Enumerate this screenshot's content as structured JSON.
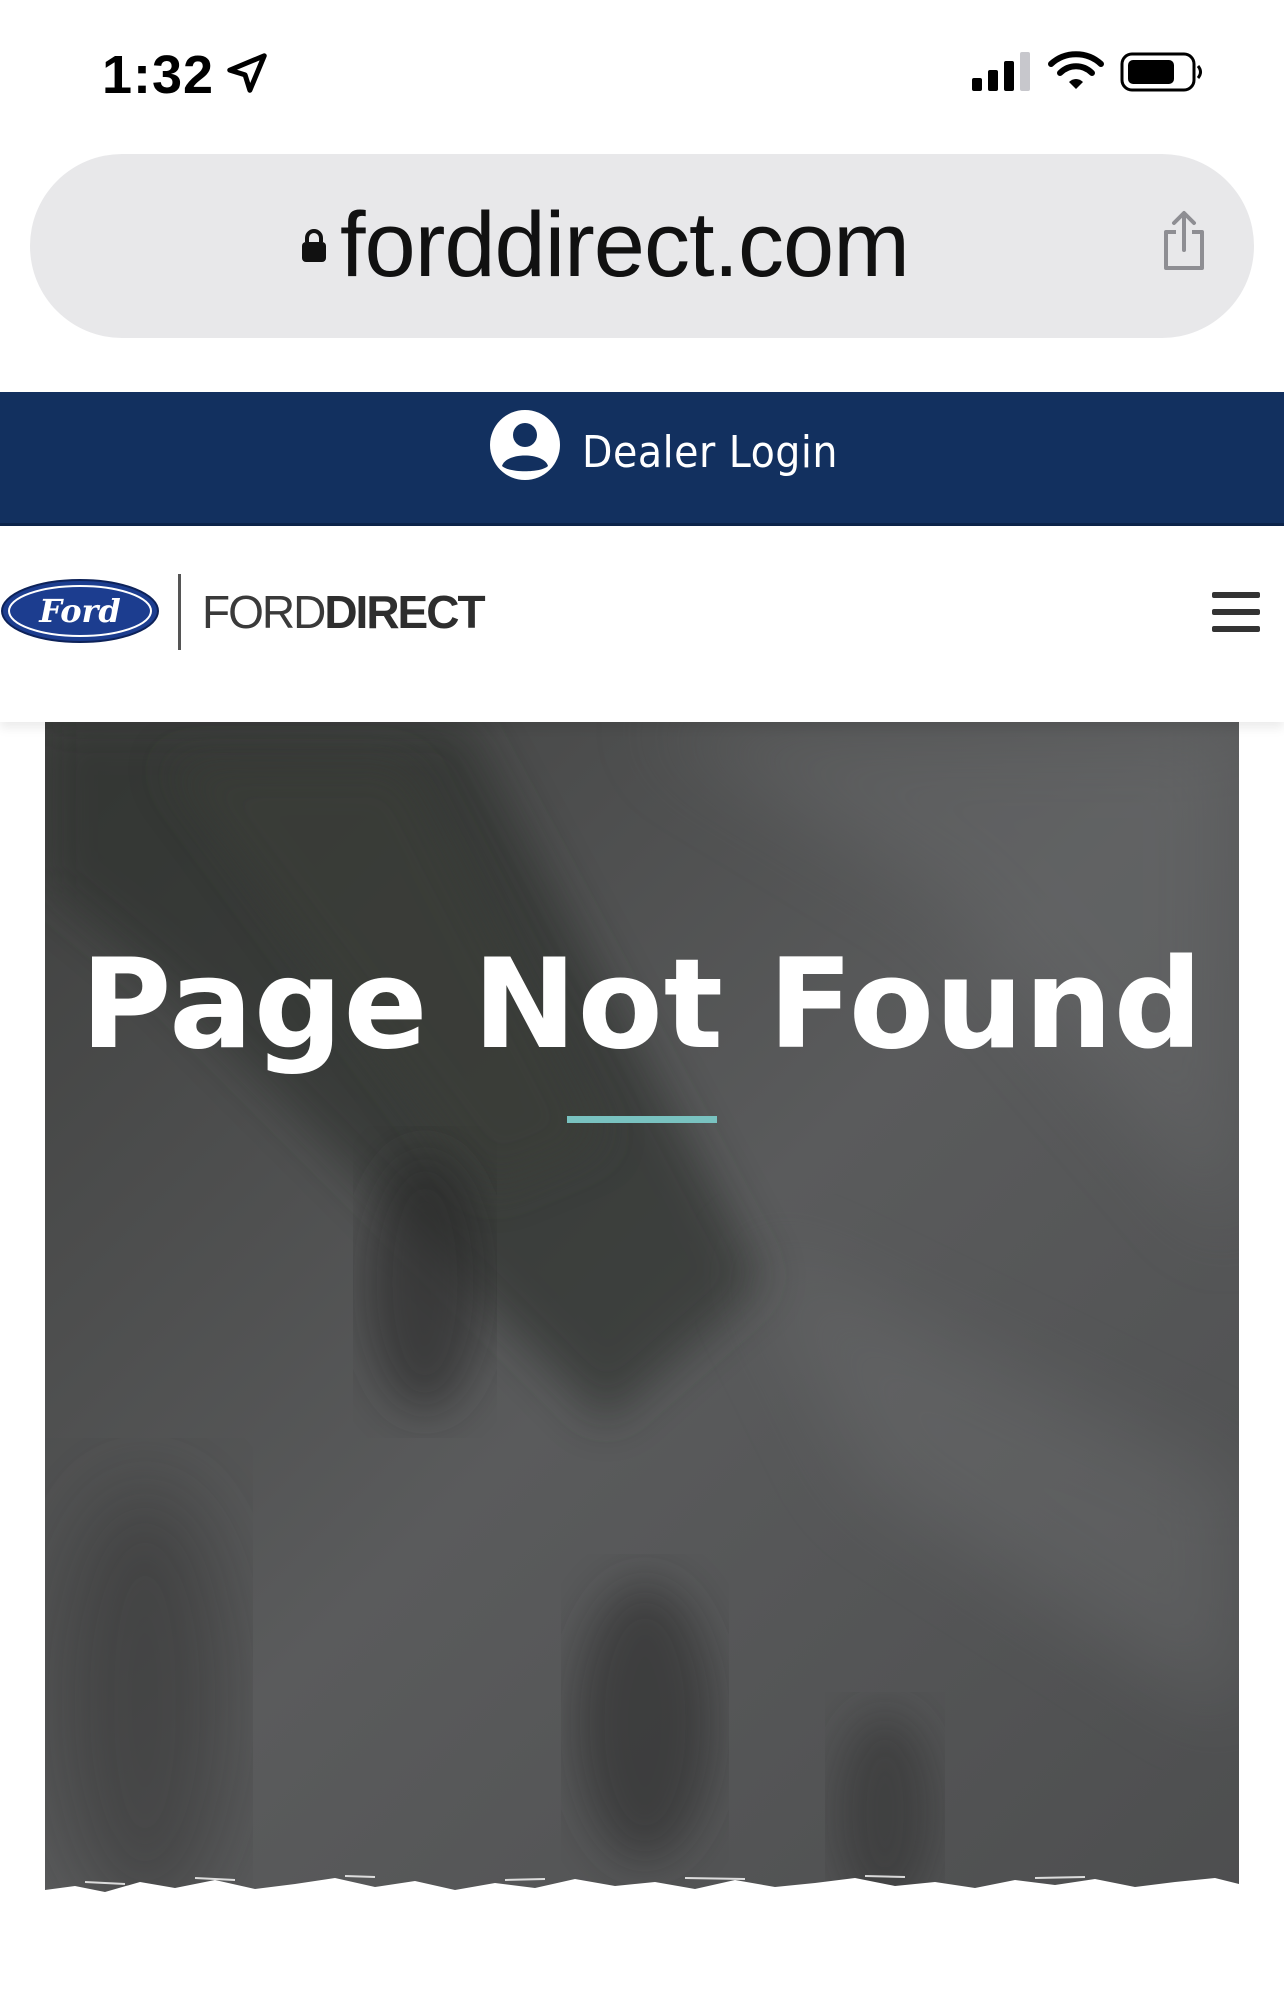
{
  "status_bar": {
    "time": "1:32",
    "icons": [
      "location-arrow-icon",
      "cellular-signal-icon",
      "wifi-icon",
      "battery-icon"
    ]
  },
  "url_bar": {
    "domain": "forddirect.com",
    "icons": [
      "lock-icon",
      "share-icon"
    ]
  },
  "dealer_bar": {
    "label": "Dealer Login",
    "icon": "user-circle-icon",
    "background": "#12305f"
  },
  "header": {
    "logo_text": "Ford",
    "brand_part1": "FORD",
    "brand_part2": "DIRECT",
    "menu_icon": "hamburger-menu-icon"
  },
  "hero": {
    "title": "Page Not Found",
    "accent_color": "#79c2c0"
  }
}
